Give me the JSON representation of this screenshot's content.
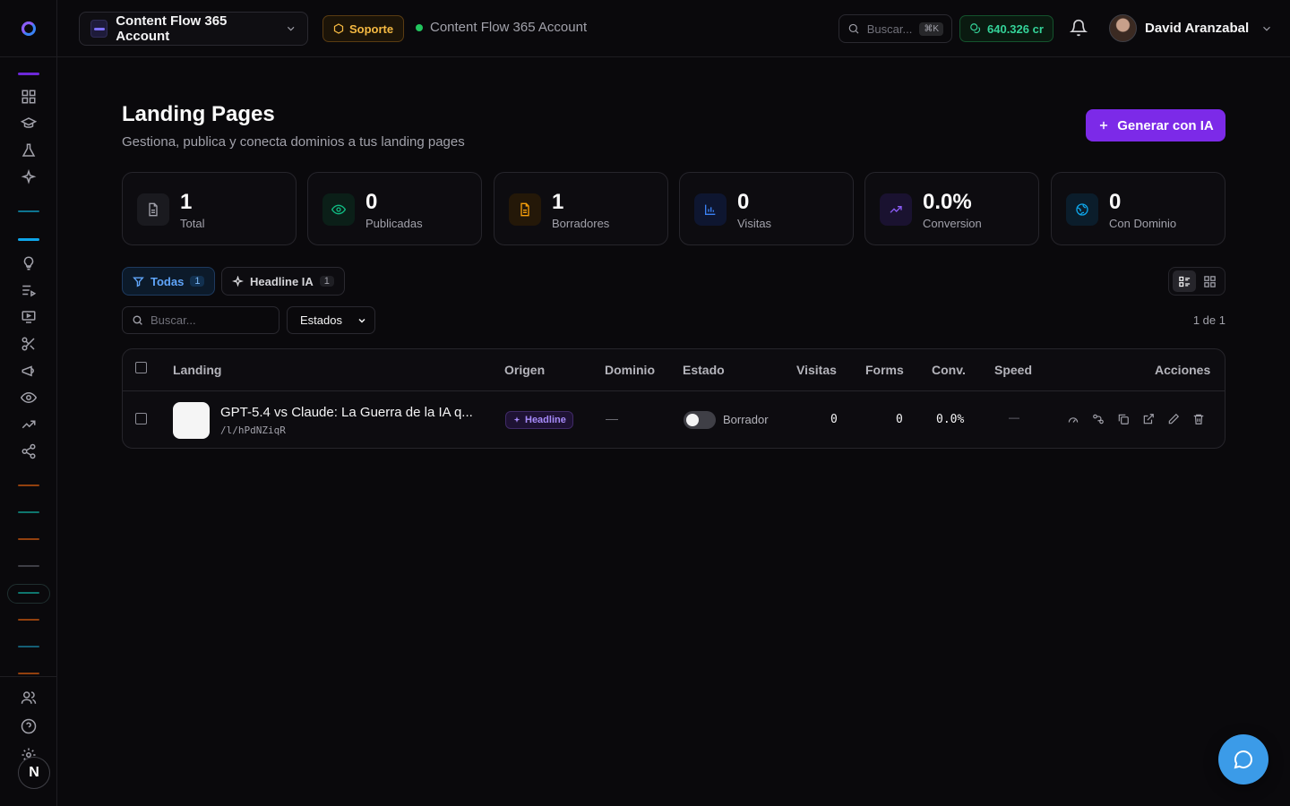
{
  "header": {
    "account_name": "Content Flow 365 Account",
    "support_label": "Soporte",
    "account_status_label": "Content Flow 365 Account",
    "search_placeholder": "Buscar...",
    "search_shortcut": "⌘K",
    "credits": "640.326 cr",
    "user_name": "David Aranzabal"
  },
  "sidebar": {
    "avatar_letter": "N",
    "icons": [
      "dashboard-icon",
      "graduation-cap-icon",
      "flask-icon",
      "sparkles-icon",
      "lightbulb-icon",
      "list-play-icon",
      "presentation-icon",
      "scissors-icon",
      "megaphone-icon",
      "eye-icon",
      "trending-up-icon",
      "share-icon",
      "users-icon",
      "help-icon",
      "gear-icon"
    ],
    "accent_colors": [
      "#7c3aed",
      "#0e7490",
      "#0ea5e9",
      "#b45309",
      "#0f766e",
      "#92400e",
      "#3f3f46",
      "#0f766e",
      "#92400e",
      "#155e75",
      "#92400e"
    ]
  },
  "page": {
    "title": "Landing Pages",
    "subtitle": "Gestiona, publica y conecta dominios a tus landing pages",
    "generate_label": "Generar con IA"
  },
  "stats": [
    {
      "value": "1",
      "label": "Total",
      "icon": "file-icon",
      "color": "#a1a1aa"
    },
    {
      "value": "0",
      "label": "Publicadas",
      "icon": "eye-icon",
      "color": "#10b981"
    },
    {
      "value": "1",
      "label": "Borradores",
      "icon": "file-text-icon",
      "color": "#f59e0b"
    },
    {
      "value": "0",
      "label": "Visitas",
      "icon": "bar-chart-icon",
      "color": "#3b82f6"
    },
    {
      "value": "0.0%",
      "label": "Conversion",
      "icon": "trending-up-icon",
      "color": "#8b5cf6"
    },
    {
      "value": "0",
      "label": "Con Dominio",
      "icon": "globe-icon",
      "color": "#0ea5e9"
    }
  ],
  "filters": {
    "all_label": "Todas",
    "all_count": "1",
    "headline_label": "Headline IA",
    "headline_count": "1",
    "list_search_placeholder": "Buscar...",
    "status_select": "Estados",
    "pager": "1 de 1"
  },
  "table": {
    "columns": [
      "Landing",
      "Origen",
      "Dominio",
      "Estado",
      "Visitas",
      "Forms",
      "Conv.",
      "Speed",
      "Acciones"
    ],
    "rows": [
      {
        "title": "GPT-5.4 vs Claude: La Guerra de la IA q...",
        "slug": "/l/hPdNZiqR",
        "origin": "Headline",
        "domain": "—",
        "state": "Borrador",
        "published": false,
        "visits": "0",
        "forms": "0",
        "conv": "0.0%",
        "speed": "—"
      }
    ]
  }
}
